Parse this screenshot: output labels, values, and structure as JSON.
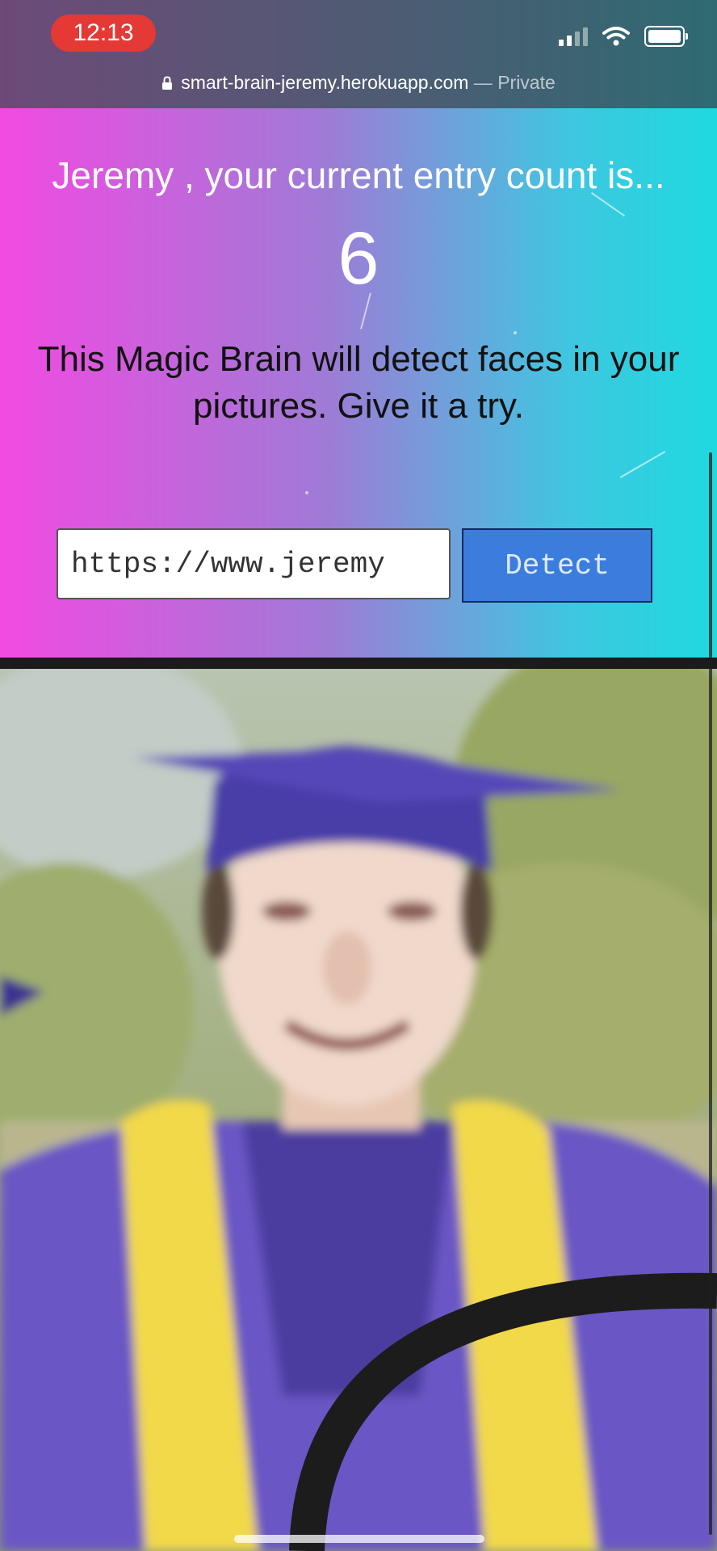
{
  "status_bar": {
    "time": "12:13"
  },
  "browser": {
    "url": "smart-brain-jeremy.herokuapp.com",
    "separator": " — ",
    "mode": "Private"
  },
  "rank": {
    "welcome": "Jeremy , your current entry count is...",
    "count": "6"
  },
  "intro": {
    "text": "This Magic Brain will detect faces in your pictures. Give it a try."
  },
  "image_form": {
    "input_value": "https://www.jeremy",
    "detect_label": "Detect"
  },
  "colors": {
    "gradient_left": "#f24ae2",
    "gradient_right": "#1fd9e0",
    "button_blue": "#3b7ddd",
    "time_pill": "#e53935"
  },
  "photo": {
    "subject": "graduate in purple cap and gown with gold stole"
  }
}
